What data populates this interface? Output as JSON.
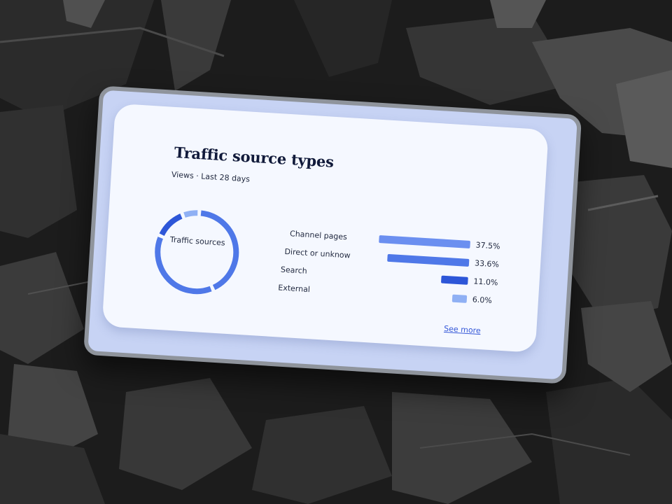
{
  "card": {
    "title": "Traffic source types",
    "subtitle": "Views · Last 28 days",
    "donut_label": "Traffic sources",
    "see_more": "See more"
  },
  "colors": {
    "accent_dark": "#2d56d8",
    "accent_mid": "#4f78e8",
    "accent_light": "#8fb0f4",
    "text": "#222a40",
    "link": "#3558d8"
  },
  "chart_data": {
    "type": "bar",
    "orientation": "horizontal",
    "categories": [
      "Channel pages",
      "Direct or unknow",
      "Search",
      "External"
    ],
    "values": [
      37.5,
      33.6,
      11.0,
      6.0
    ],
    "value_labels": [
      "37.5%",
      "33.6%",
      "11.0%",
      "6.0%"
    ],
    "bar_colors": [
      "#6b8ff0",
      "#4f78e8",
      "#2d56d8",
      "#8fb0f4"
    ],
    "xlim": [
      0,
      40
    ]
  }
}
